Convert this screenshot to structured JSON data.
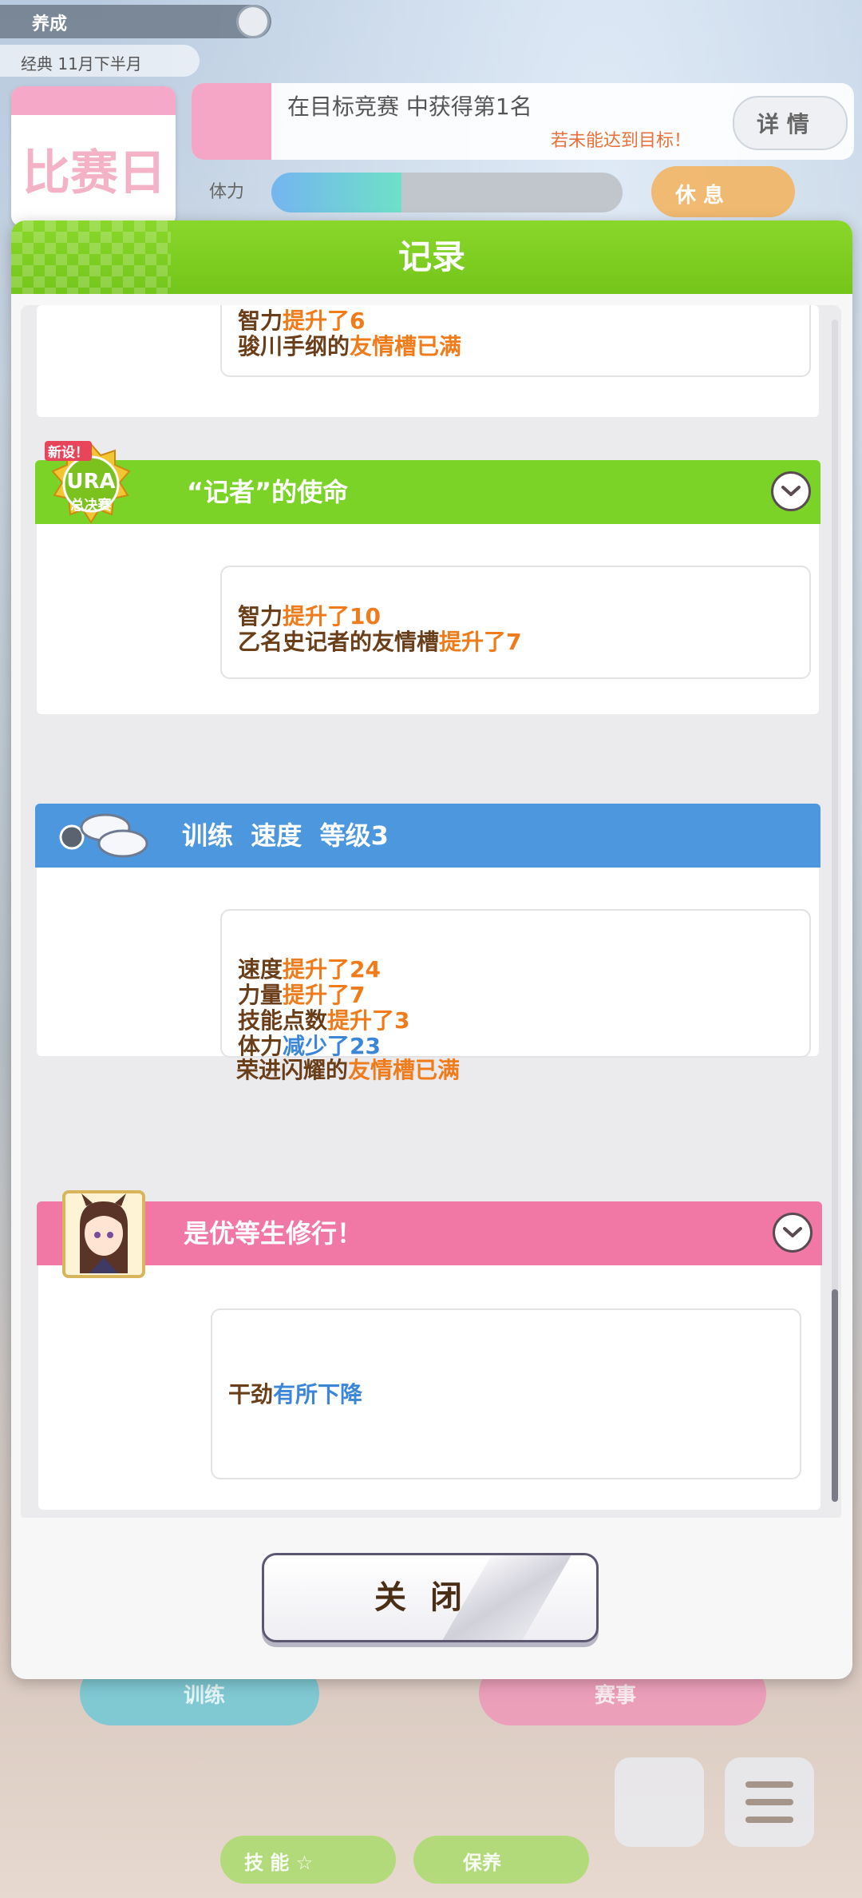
{
  "background": {
    "top_bar": "养成",
    "turn_info": "经典 11月下半月",
    "calendar_label": "比赛日",
    "goal_text": "在目标竞赛 中获得第1名",
    "goal_sub": "若未能达到目标！",
    "goal_button": "详 情",
    "energy_label": "体力",
    "energy_fraction": 0.37,
    "orange_button": "休 息",
    "bottom_left": "训练",
    "bottom_right": "赛事",
    "green_left": "技 能 ☆",
    "green_right": "保养",
    "colors": {
      "accent_green": "#7cc91e",
      "banner_blue": "#4d97de",
      "banner_pink": "#f177a4"
    }
  },
  "dialog": {
    "title": "记录",
    "close_label": "关闭",
    "events": [
      {
        "id": "prev",
        "lines": [
          [
            {
              "t": "智力",
              "c": "brown"
            },
            {
              "t": "提升了6",
              "c": "orange"
            }
          ],
          [
            {
              "t": "骏川手纲的",
              "c": "brown"
            },
            {
              "t": "友情槽已满",
              "c": "orange"
            }
          ]
        ]
      },
      {
        "id": "reporter",
        "icon": "ura-finals-badge-icon",
        "badge_top": "新设！",
        "badge_mid": "URA",
        "badge_bottom": "总决赛",
        "title": "“记者”的使命",
        "color": "#7cd328",
        "lines": [
          [
            {
              "t": "智力",
              "c": "brown"
            },
            {
              "t": "提升了10",
              "c": "orange"
            }
          ],
          [
            {
              "t": "乙名史记者的友情槽",
              "c": "brown"
            },
            {
              "t": "提升了7",
              "c": "orange"
            }
          ]
        ]
      },
      {
        "id": "training",
        "icon": "training-shoes-icon",
        "title": "训练  速度  等级3",
        "color": "#4d97de",
        "lines": [
          [
            {
              "t": "速度",
              "c": "brown"
            },
            {
              "t": "提升了24",
              "c": "orange"
            }
          ],
          [
            {
              "t": "力量",
              "c": "brown"
            },
            {
              "t": "提升了7",
              "c": "orange"
            }
          ],
          [
            {
              "t": "技能点数",
              "c": "brown"
            },
            {
              "t": "提升了3",
              "c": "orange"
            }
          ],
          [
            {
              "t": "体力",
              "c": "brown"
            },
            {
              "t": "减少了23",
              "c": "blue"
            }
          ],
          [
            {
              "t": "荣进闪耀的",
              "c": "brown"
            },
            {
              "t": "友情槽已满",
              "c": "orange"
            }
          ]
        ]
      },
      {
        "id": "honor-student",
        "icon": "character-portrait-icon",
        "title": "是优等生修行！",
        "color": "#f177a4",
        "lines": [
          [
            {
              "t": "干劲",
              "c": "brown"
            },
            {
              "t": "有所下降",
              "c": "blue"
            }
          ]
        ]
      }
    ]
  }
}
